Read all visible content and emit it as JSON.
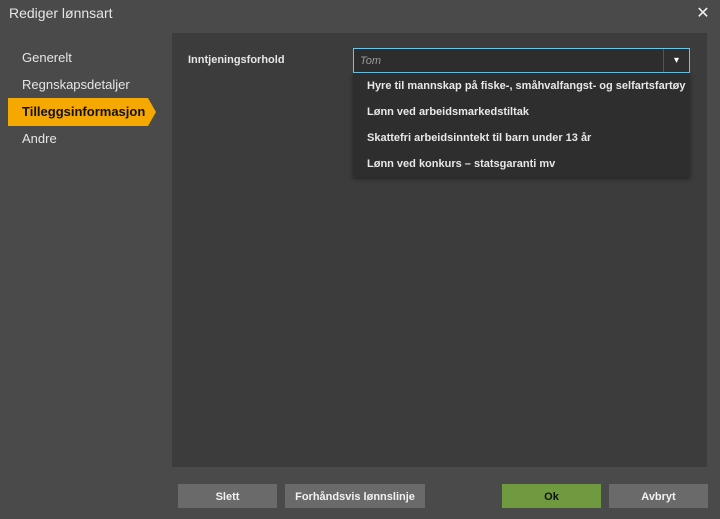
{
  "window": {
    "title": "Rediger lønnsart",
    "close_icon": "close-icon"
  },
  "sidebar": {
    "items": [
      {
        "label": "Generelt",
        "active": false
      },
      {
        "label": "Regnskapsdetaljer",
        "active": false
      },
      {
        "label": "Tilleggsinformasjon",
        "active": true
      },
      {
        "label": "Andre",
        "active": false
      }
    ],
    "active_color": "#f5a800"
  },
  "form": {
    "label": "Inntjeningsforhold",
    "combo": {
      "value": "",
      "placeholder": "Tom"
    },
    "options": [
      "Hyre til mannskap på fiske-, småhvalfangst- og selfartsfartøy",
      "Lønn ved arbeidsmarkedstiltak",
      "Skattefri arbeidsinntekt til barn under 13 år",
      "Lønn ved konkurs – statsgaranti mv"
    ]
  },
  "footer": {
    "delete_label": "Slett",
    "preview_label": "Forhåndsvis lønnslinje",
    "ok_label": "Ok",
    "cancel_label": "Avbryt",
    "ok_color": "#6f9a3f"
  }
}
